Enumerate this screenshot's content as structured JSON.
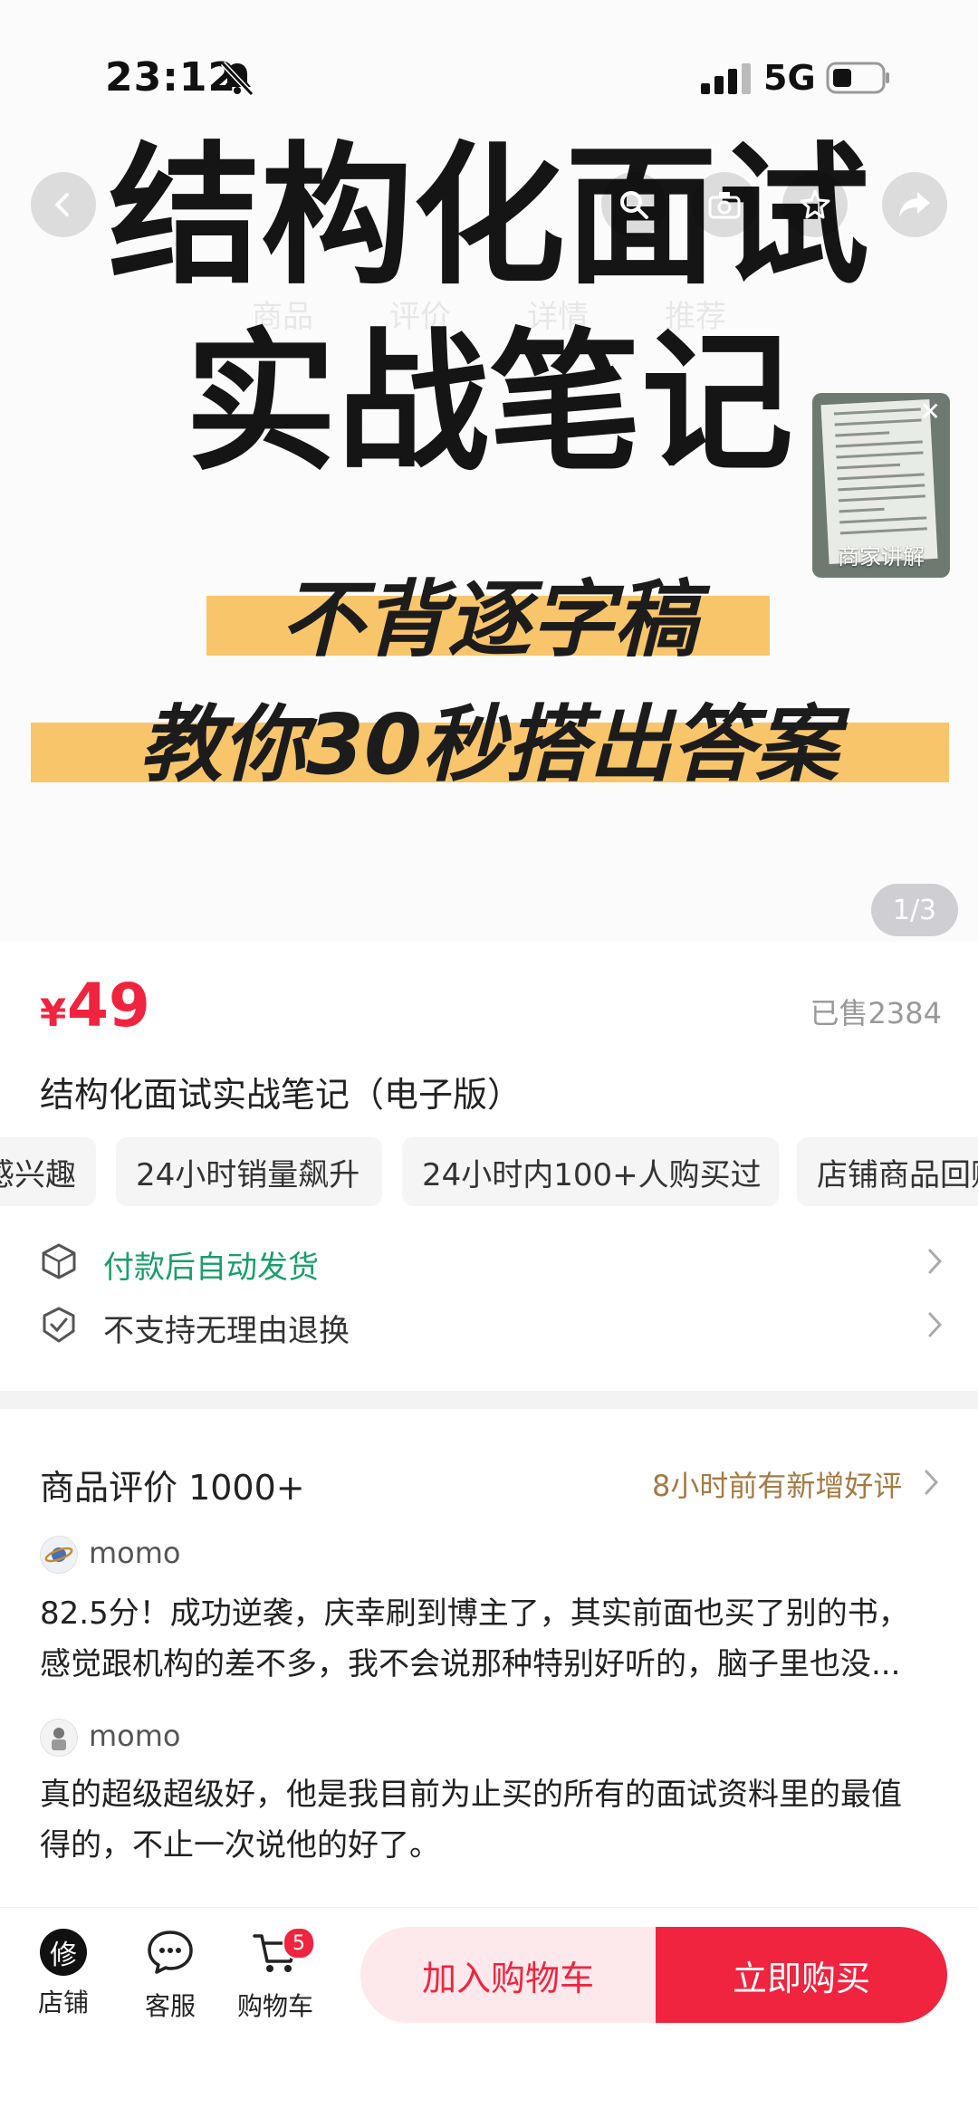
{
  "status_bar": {
    "time": "23:12",
    "network": "5G"
  },
  "hero": {
    "title_line1": "结构化面试",
    "title_line2": "实战笔记",
    "slogan_line1": "不背逐字稿",
    "slogan_line2": "教你30秒搭出答案",
    "highlight_color": "#f8c56a",
    "faint_tabs": [
      "商品",
      "评价",
      "详情",
      "推荐"
    ],
    "video_label": "商家讲解",
    "counter": "1/3"
  },
  "product": {
    "price_currency": "¥",
    "price": "49",
    "sold": "已售2384",
    "title": "结构化面试实战笔记（电子版）",
    "tags": [
      "感兴趣",
      "24小时销量飙升",
      "24小时内100+人购买过",
      "店铺商品回购"
    ],
    "accent_color": "#f0243f"
  },
  "services": [
    {
      "text": "付款后自动发货",
      "color": "#1a9e6b",
      "icon": "box-icon"
    },
    {
      "text": "不支持无理由退换",
      "color": "#333333",
      "icon": "shield-check-icon"
    }
  ],
  "reviews": {
    "heading": "商品评价 1000+",
    "new_note": "8小时前有新增好评",
    "items": [
      {
        "user": "momo",
        "text_line1": "82.5分！成功逆袭，庆幸刷到博主了，其实前面也买了别的书，",
        "text_line2": "感觉跟机构的差不多，我不会说那种特别好听的，脑子里也没..."
      },
      {
        "user": "momo",
        "text_line1": "真的超级超级好，他是我目前为止买的所有的面试资料里的最值",
        "text_line2": "得的，不止一次说他的好了。"
      }
    ]
  },
  "bottom_bar": {
    "shop_logo": "修",
    "shop": "店铺",
    "service": "客服",
    "cart": "购物车",
    "cart_count": "5",
    "add_to_cart": "加入购物车",
    "buy_now": "立即购买"
  }
}
